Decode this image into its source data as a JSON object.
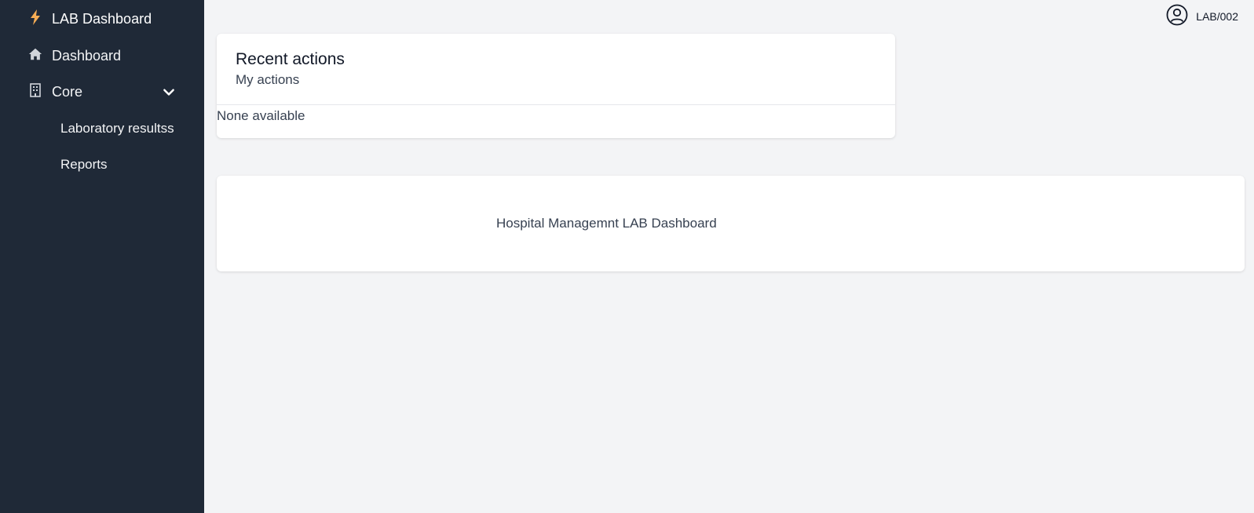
{
  "sidebar": {
    "brand": {
      "label": "LAB Dashboard",
      "icon": "bolt-icon",
      "icon_color": "#f6ad55"
    },
    "items": [
      {
        "label": "Dashboard",
        "icon": "home-icon"
      },
      {
        "label": "Core",
        "icon": "building-icon",
        "expanded": true
      }
    ],
    "sub_items": [
      {
        "label": "Laboratory resultss"
      },
      {
        "label": "Reports"
      }
    ]
  },
  "topbar": {
    "user_label": "LAB/002",
    "user_icon": "user-circle-icon"
  },
  "recent_actions": {
    "title": "Recent actions",
    "subtitle": "My actions",
    "empty_text": "None available"
  },
  "footer_card": {
    "text": "Hospital Managemnt LAB Dashboard"
  },
  "colors": {
    "sidebar_bg": "#1f2937",
    "page_bg": "#f3f4f6",
    "card_bg": "#ffffff"
  }
}
